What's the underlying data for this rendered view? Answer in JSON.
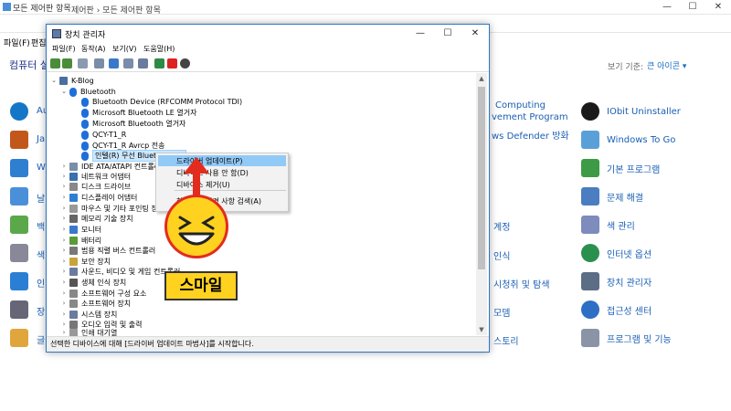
{
  "background": {
    "title": "모든 제어판 항목",
    "address": "제어판 › 모든 제어판 항목",
    "menu_file": "파일(F)",
    "menu_edit": "편집",
    "heading": "컴퓨터 설",
    "view_label": "보기 기준:",
    "view_value": "큰 아이콘 ▾",
    "left_items": [
      "Au",
      "Ja",
      "W",
      "날",
      "백",
      "색",
      "인",
      "장",
      "글"
    ],
    "mid_items": [
      "Computing",
      "vement Program",
      "ws Defender 방화",
      "계정",
      "인식",
      "시청취 및 탐색",
      "모뎀",
      "스토리"
    ],
    "right_items": [
      "IObit Uninstaller",
      "Windows To Go",
      "기본 프로그램",
      "문제 해결",
      "색 관리",
      "인터넷 옵션",
      "장치 관리자",
      "접근성 센터",
      "프로그램 및 기능"
    ],
    "controls": [
      "—",
      "☐",
      "✕"
    ]
  },
  "device_manager": {
    "title": "장치 관리자",
    "controls": [
      "—",
      "☐",
      "✕"
    ],
    "menu": [
      "파일(F)",
      "동작(A)",
      "보기(V)",
      "도움말(H)"
    ],
    "tree": {
      "root": "K-Blog",
      "bluetooth": "Bluetooth",
      "bt_children": [
        "Bluetooth Device (RFCOMM Protocol TDI)",
        "Microsoft Bluetooth LE 열거자",
        "Microsoft Bluetooth 열거자",
        "QCY-T1_R",
        "QCY-T1_R Avrcp 전송",
        "인텔(R) 무선 Bluetooth(R)"
      ],
      "categories": [
        "IDE ATA/ATAPI 컨트롤러",
        "네트워크 어댑터",
        "디스크 드라이브",
        "디스플레이 어댑터",
        "마우스 및 기타 포인팅 장치",
        "메모리 기술 장치",
        "모니터",
        "배터리",
        "범용 직렬 버스 컨트롤러",
        "보안 장치",
        "사운드, 비디오 및 게임 컨트롤러",
        "생체 인식 장치",
        "소프트웨어 구성 요소",
        "소프트웨어 장치",
        "시스템 장치",
        "오디오 입력 및 출력",
        "인쇄 대기열"
      ]
    },
    "status": "선택한 디바이스에 대해 [드라이버 업데이트 마법사]를 시작합니다."
  },
  "context_menu": {
    "items": [
      "드라이버 업데이트(P)",
      "디바이스 사용 안 함(D)",
      "디바이스 제거(U)",
      "하드웨어 변경 사항 검색(A)"
    ]
  },
  "overlay": {
    "label": "스마일"
  },
  "colors": {
    "accent": "#1a5fb4",
    "highlight": "#91c9f7",
    "arrow": "#e32b1e",
    "smiley": "#ffd21f"
  }
}
